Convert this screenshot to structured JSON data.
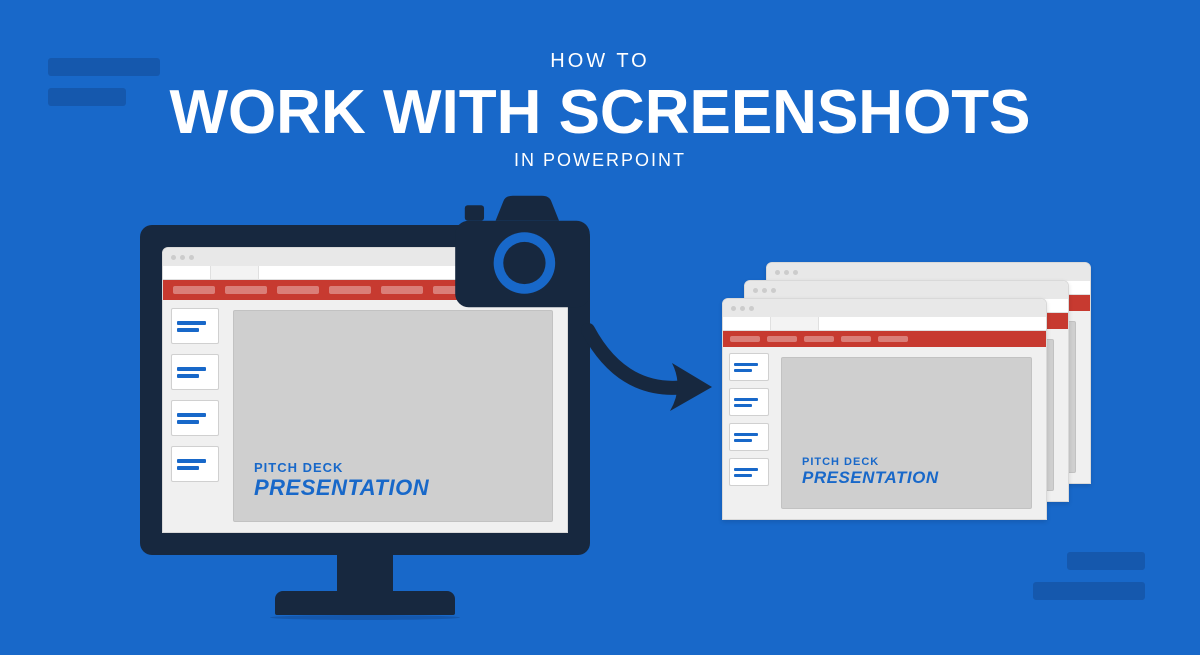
{
  "heading": {
    "line1": "HOW TO",
    "line2": "WORK WITH SCREENSHOTS",
    "line3": "IN POWERPOINT"
  },
  "slide": {
    "subtitle": "PITCH DECK",
    "title": "PRESENTATION"
  },
  "icons": {
    "camera": "camera-icon",
    "arrow": "arrow-right-icon"
  },
  "colors": {
    "bg": "#1868c9",
    "dark": "#17283f",
    "accent": "#1558ad",
    "ribbon": "#c73a30"
  }
}
